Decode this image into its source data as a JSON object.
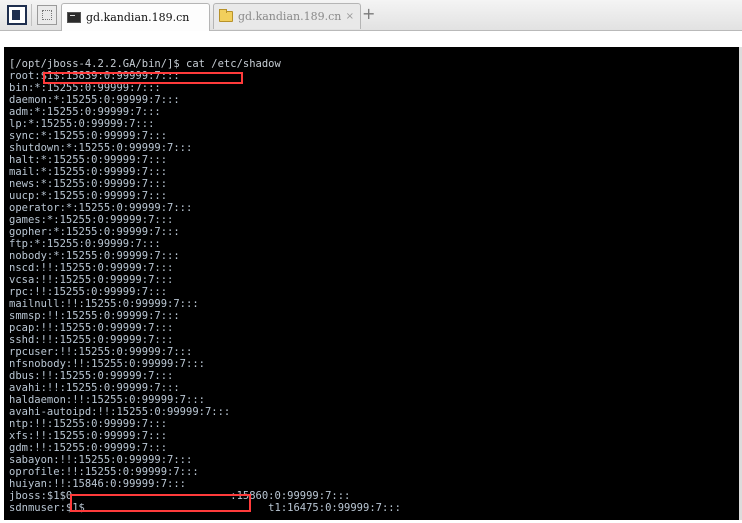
{
  "tabs": [
    {
      "label": "gd.kandian.189.cn",
      "active": true,
      "icon": "terminal-icon"
    },
    {
      "label": "gd.kandian.189.cn",
      "active": false,
      "icon": "folder-icon",
      "close": "×"
    }
  ],
  "add_tab_label": "+",
  "terminal": {
    "lines": [
      "[/opt/jboss-4.2.2.GA/bin/]$ cat /etc/shadow",
      "root:$1$:15839:0:99999:7:::",
      "bin:*:15255:0:99999:7:::",
      "daemon:*:15255:0:99999:7:::",
      "adm:*:15255:0:99999:7:::",
      "lp:*:15255:0:99999:7:::",
      "sync:*:15255:0:99999:7:::",
      "shutdown:*:15255:0:99999:7:::",
      "halt:*:15255:0:99999:7:::",
      "mail:*:15255:0:99999:7:::",
      "news:*:15255:0:99999:7:::",
      "uucp:*:15255:0:99999:7:::",
      "operator:*:15255:0:99999:7:::",
      "games:*:15255:0:99999:7:::",
      "gopher:*:15255:0:99999:7:::",
      "ftp:*:15255:0:99999:7:::",
      "nobody:*:15255:0:99999:7:::",
      "nscd:!!:15255:0:99999:7:::",
      "vcsa:!!:15255:0:99999:7:::",
      "rpc:!!:15255:0:99999:7:::",
      "mailnull:!!:15255:0:99999:7:::",
      "smmsp:!!:15255:0:99999:7:::",
      "pcap:!!:15255:0:99999:7:::",
      "sshd:!!:15255:0:99999:7:::",
      "rpcuser:!!:15255:0:99999:7:::",
      "nfsnobody:!!:15255:0:99999:7:::",
      "dbus:!!:15255:0:99999:7:::",
      "avahi:!!:15255:0:99999:7:::",
      "haldaemon:!!:15255:0:99999:7:::",
      "avahi-autoipd:!!:15255:0:99999:7:::",
      "ntp:!!:15255:0:99999:7:::",
      "xfs:!!:15255:0:99999:7:::",
      "gdm:!!:15255:0:99999:7:::",
      "sabayon:!!:15255:0:99999:7:::",
      "oprofile:!!:15255:0:99999:7:::",
      "huiyan:!!:15846:0:99999:7:::",
      "jboss:$1$0                         :15860:0:99999:7:::",
      "sdnmuser:$1$                             t1:16475:0:99999:7:::"
    ]
  },
  "colors": {
    "terminal_bg": "#000000",
    "terminal_text": "#b9c6d3",
    "redaction": "#ff3b3b"
  }
}
